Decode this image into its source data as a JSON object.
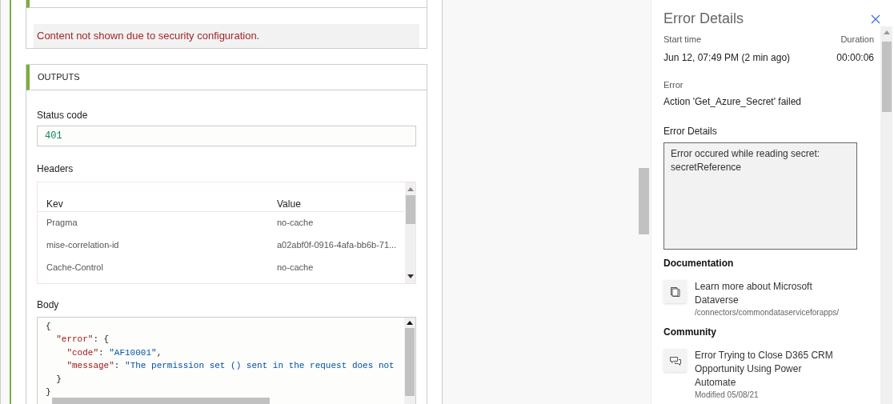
{
  "inputs": {
    "security_message": "Content not shown due to security configuration."
  },
  "outputs": {
    "title": "OUTPUTS",
    "status_label": "Status code",
    "status_value": "401",
    "headers_label": "Headers",
    "headers": {
      "columns": [
        "Kev",
        "Value"
      ],
      "rows": [
        {
          "key": "Pragma",
          "value": "no-cache"
        },
        {
          "key": "mise-correlation-id",
          "value": "a02abf0f-0916-4afa-bb6b-71..."
        },
        {
          "key": "Cache-Control",
          "value": "no-cache"
        }
      ]
    },
    "body_label": "Body",
    "body_lines": [
      [
        {
          "kind": "punct",
          "text": "{"
        }
      ],
      [
        {
          "kind": "key",
          "text": "  \"error\""
        },
        {
          "kind": "punct",
          "text": ": {"
        }
      ],
      [
        {
          "kind": "key",
          "text": "    \"code\""
        },
        {
          "kind": "punct",
          "text": ": "
        },
        {
          "kind": "string",
          "text": "\"AF10001\""
        },
        {
          "kind": "punct",
          "text": ","
        }
      ],
      [
        {
          "kind": "key",
          "text": "    \"message\""
        },
        {
          "kind": "punct",
          "text": ": "
        },
        {
          "kind": "string",
          "text": "\"The permission set () sent in the request does not"
        }
      ],
      [
        {
          "kind": "punct",
          "text": "  }"
        }
      ],
      [
        {
          "kind": "punct",
          "text": "}"
        }
      ]
    ]
  },
  "panel": {
    "title": "Error Details",
    "start_label": "Start time",
    "start_value": "Jun 12, 07:49 PM (2 min ago)",
    "duration_label": "Duration",
    "duration_value": "00:00:06",
    "error_label": "Error",
    "error_value": "Action 'Get_Azure_Secret' failed",
    "details_label": "Error Details",
    "details_text": "Error occured while reading secret: secretReference",
    "sections": [
      {
        "title": "Documentation",
        "items": [
          {
            "kind": "doc",
            "title": "Learn more about Microsoft Dataverse",
            "sub": "/connectors/commondataserviceforapps/"
          }
        ]
      },
      {
        "title": "Community",
        "items": [
          {
            "kind": "chat",
            "title": "Error Trying to Close D365 CRM Opportunity Using Power Automate",
            "sub": "Modified 05/08/21"
          }
        ]
      }
    ]
  }
}
